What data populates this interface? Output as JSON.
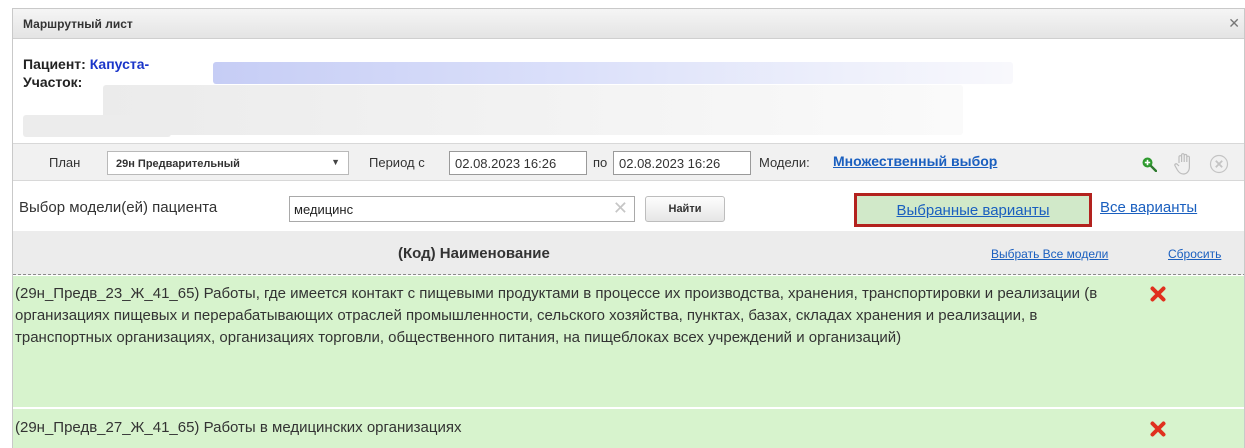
{
  "window": {
    "title": "Маршрутный лист",
    "close_icon": "close-icon"
  },
  "patient": {
    "patient_label": "Пациент:",
    "patient_name": "Капуста-",
    "district_label": "Участок:"
  },
  "filter": {
    "plan_label": "План",
    "plan_value": "29н Предварительный",
    "period_label": "Период с",
    "date_from": "02.08.2023 16:26",
    "to_label": "по",
    "date_to": "02.08.2023 16:26",
    "models_label": "Модели:",
    "models_link": "Множественный выбор",
    "icons": [
      "zoom-in-icon",
      "hand-icon",
      "clear-circle-icon"
    ]
  },
  "search": {
    "label": "Выбор модели(ей) пациента",
    "value": "медицинс",
    "find_button": "Найти",
    "selected_variants": "Выбранные варианты",
    "all_variants": "Все варианты"
  },
  "table": {
    "column_header": "(Код) Наименование",
    "select_all_link": "Выбрать Все модели",
    "reset_link": "Сбросить",
    "rows": [
      {
        "text": "(29н_Предв_23_Ж_41_65) Работы, где имеется контакт с пищевыми продуктами в процессе их производства, хранения, транспортировки и реализации (в организациях пищевых и перерабатывающих отраслей промышленности, сельского хозяйства, пунктах, базах, складах хранения и реализации, в транспортных организациях, организациях торговли, общественного питания, на пищеблоках всех учреждений и организаций)"
      },
      {
        "text": "(29н_Предв_27_Ж_41_65) Работы в медицинских организациях"
      }
    ]
  },
  "colors": {
    "link": "#1a5fbf",
    "patient_name": "#1a35c9",
    "row_bg": "#d7f3cd",
    "highlight_border": "#b3221e",
    "delete_icon": "#e0301e"
  }
}
